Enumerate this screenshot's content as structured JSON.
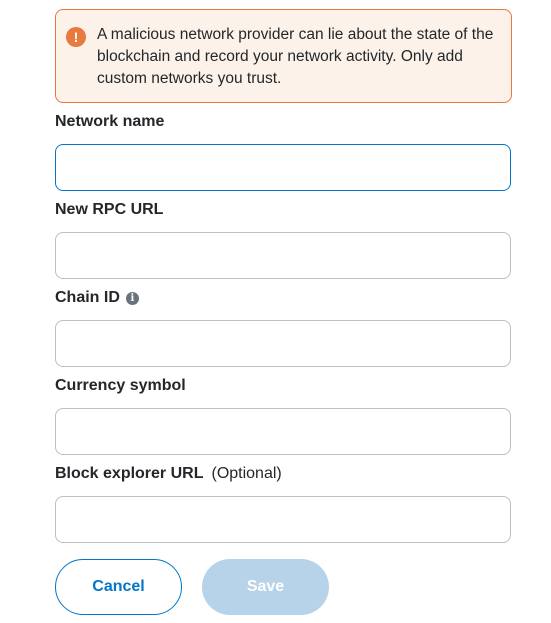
{
  "warning": {
    "icon": "exclamation-icon",
    "glyph": "!",
    "text": "A malicious network provider can lie about the state of the blockchain and record your network activity. Only add custom networks you trust."
  },
  "fields": {
    "network_name": {
      "label": "Network name",
      "value": ""
    },
    "rpc_url": {
      "label": "New RPC URL",
      "value": ""
    },
    "chain_id": {
      "label": "Chain ID",
      "info_icon": "info-icon",
      "info_glyph": "i",
      "value": ""
    },
    "currency_symbol": {
      "label": "Currency symbol",
      "value": ""
    },
    "block_explorer": {
      "label": "Block explorer URL",
      "optional": "(Optional)",
      "value": ""
    }
  },
  "buttons": {
    "cancel_label": "Cancel",
    "save_label": "Save",
    "save_disabled": true
  },
  "colors": {
    "accent": "#0376c9",
    "warning": "#e8793f",
    "warning_bg": "#fcf2e9",
    "disabled": "#b6d3ea"
  }
}
